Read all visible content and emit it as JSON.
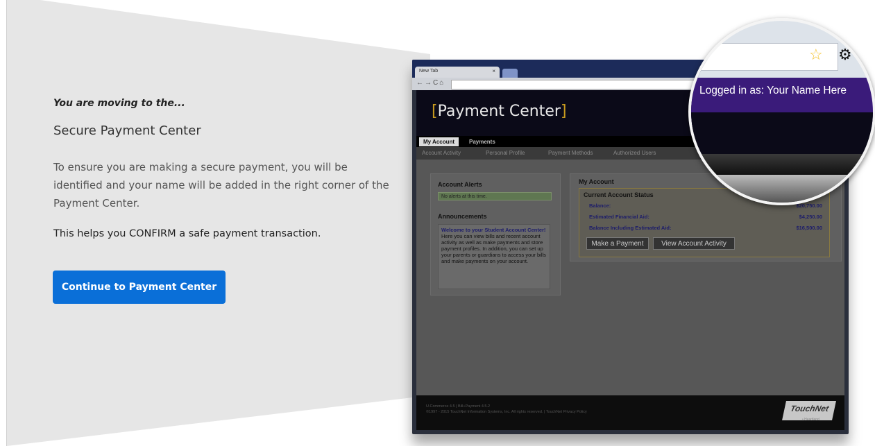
{
  "intro": {
    "moving_to": "You are moving to the...",
    "title": "Secure Payment Center",
    "description": "To ensure you are making a secure payment, you will be identified and your name will be added in the right corner of the Payment Center.",
    "confirm": "This helps you CONFIRM a safe payment transaction.",
    "continue_label": "Continue to Payment Center"
  },
  "browser": {
    "tab_title": "New Tab",
    "tab_close": "×"
  },
  "site": {
    "logo_text": "Payment Center",
    "logo_open": "[",
    "logo_close": "]",
    "main_tabs": [
      "My Account",
      "Payments"
    ],
    "sub_nav": [
      "Account Activity",
      "Personal Profile",
      "Payment Methods",
      "Authorized Users"
    ],
    "alerts_title": "Account Alerts",
    "no_alerts": "No alerts at this time.",
    "announcements_title": "Announcements",
    "welcome_title": "Welcome to your Student Account Center!",
    "welcome_body": "Here you can view bills and recent account activity as well as make payments and store payment profiles. In addition, you can set up your parents or guardians to access your bills and make payments on your account.",
    "my_account_title": "My Account",
    "status_title": "Current Account Status",
    "status_rows": [
      {
        "label": "Balance:",
        "value": "$20,750.00"
      },
      {
        "label": "Estimated Financial Aid:",
        "value": "$4,250.00"
      },
      {
        "label": "Balance Including Estimated Aid:",
        "value": "$16,500.00"
      }
    ],
    "make_payment": "Make a Payment",
    "view_activity": "View Account Activity",
    "footer_line1": "U.Commerce 4.5 | Bill+Payment 4.5.2",
    "footer_line2": "©1997 - 2015 TouchNet Information Systems, Inc. All rights reserved. | TouchNet Privacy Policy",
    "touchnet_logo": "TouchNet",
    "touchnet_sub": "• Heartland"
  },
  "magnifier": {
    "logged_in_text": "Logged in as: Your Name Here",
    "star_icon": "☆",
    "gear_icon": "⚙"
  },
  "colors": {
    "button": "#0a6fd8",
    "purple_bar": "#3a1b7a",
    "logo_bracket": "#c79a1e"
  }
}
